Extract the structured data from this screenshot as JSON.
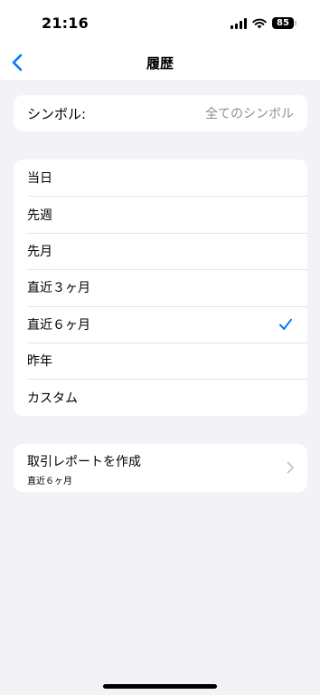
{
  "status_bar": {
    "time": "21:16",
    "battery_level": "85",
    "icons": [
      "signal-icon",
      "wifi-icon",
      "battery-icon"
    ]
  },
  "nav": {
    "title": "履歴",
    "back_icon": "chevron-left-icon",
    "accent_color": "#007aff"
  },
  "symbol": {
    "label": "シンボル:",
    "value": "全てのシンボル"
  },
  "periods": {
    "items": [
      {
        "label": "当日"
      },
      {
        "label": "先週"
      },
      {
        "label": "先月"
      },
      {
        "label": "直近３ヶ月"
      },
      {
        "label": "直近６ヶ月"
      },
      {
        "label": "昨年"
      },
      {
        "label": "カスタム"
      }
    ],
    "selected": "直近６ヶ月",
    "selected_icon": "checkmark-icon"
  },
  "report": {
    "title": "取引レポートを作成",
    "subtitle": "直近６ヶ月",
    "icon": "chevron-right-icon"
  }
}
